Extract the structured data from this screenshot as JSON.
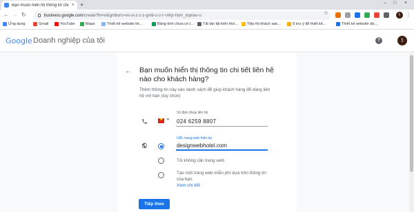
{
  "browser": {
    "tab_title": "Bạn muốn hiển thị thông tin chi",
    "tab_close": "×",
    "new_tab": "+",
    "window_controls": [
      "–",
      "□",
      "×"
    ],
    "nav": {
      "back": "←",
      "forward": "→",
      "reload": "↻"
    },
    "url_host": "business.google.com",
    "url_path": "/create?hl=vi&gmbsrc=vn-vi-z-z-z-gmb-s-z-l~mhp-hom_topnav-u",
    "star": "☆",
    "profile_initial": "t",
    "menu": "⋮"
  },
  "bookmarks": [
    {
      "label": "Ứng dụng",
      "color": "#4285f4"
    },
    {
      "label": "Gmail",
      "color": "#ea4335"
    },
    {
      "label": "YouTube",
      "color": "#ff0000"
    },
    {
      "label": "Maps",
      "color": "#34a853"
    },
    {
      "label": "Thiết kế website kh...",
      "color": "#8ab4f8"
    },
    {
      "label": "Bảng tính chưa có t...",
      "color": "#0f9d58"
    },
    {
      "label": "Tất tần tật kiến thứ...",
      "color": "#5f6368"
    },
    {
      "label": "Tiếp thị khách sạn...",
      "color": "#fbbc04"
    },
    {
      "label": "8 lưu ý để thiết kế...",
      "color": "#f9ab00"
    },
    {
      "label": "Thiết kế website dịc...",
      "color": "#1a73e8"
    }
  ],
  "header": {
    "logo_google": "Google",
    "product_name": "Doanh nghiệp của tôi",
    "help_icon_glyph": "?",
    "avatar_initial": "t"
  },
  "form": {
    "back_arrow": "←",
    "title": "Bạn muốn hiển thị thông tin chi tiết liên hệ nào cho khách hàng?",
    "subtitle": "Thêm thông tin này vào danh sách để giúp khách hàng để dàng liên hệ với bạn (tùy chọn)",
    "phone_label": "Số điện thoại liên hệ",
    "phone_value": "024 6259 8807",
    "country_caret": "▼",
    "url_label": "URL trang web hiện tại",
    "url_value": "designwebhotel.com",
    "option_no_website": "Tôi không cần trang web",
    "option_free_website": "Tạo một trang web miễn phí dựa trên thông tin của bạn.",
    "see_details_link": "Xem chi tiết",
    "next_button": "Tiếp theo",
    "selected_option": "current-url"
  },
  "colors": {
    "accent": "#1a73e8",
    "text_primary": "#202124",
    "text_secondary": "#5f6368"
  }
}
